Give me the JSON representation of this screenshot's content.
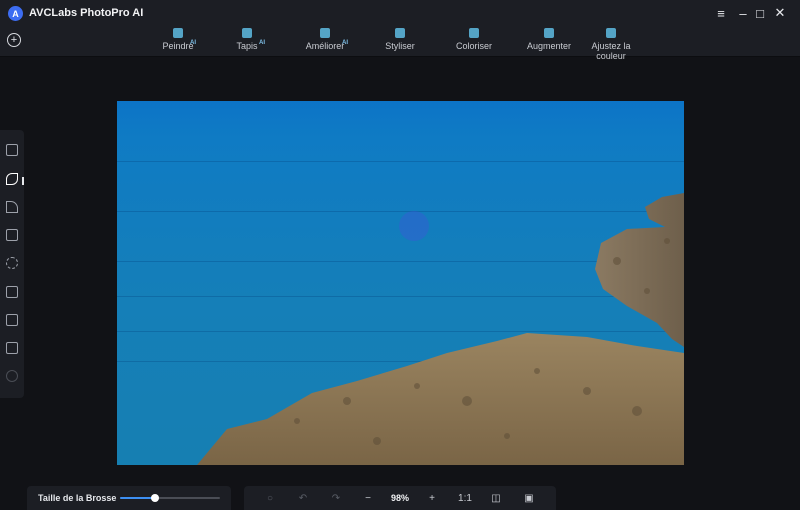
{
  "app": {
    "title": "AVCLabs PhotoPro AI",
    "logo_letter": "A"
  },
  "window_controls": [
    {
      "name": "menu-icon",
      "glyph": "≡"
    },
    {
      "name": "minimize-icon",
      "glyph": "–"
    },
    {
      "name": "maximize-icon",
      "glyph": "□"
    },
    {
      "name": "close-icon",
      "glyph": "✕"
    }
  ],
  "toolbar": {
    "add_glyph": "+",
    "tools": [
      {
        "label": "Peindre",
        "ai": "AI",
        "icon": "paint-icon"
      },
      {
        "label": "Tapis",
        "ai": "AI",
        "icon": "carpet-icon"
      },
      {
        "label": "Améliorer",
        "ai": "AI",
        "icon": "enhance-icon"
      },
      {
        "label": "Styliser",
        "ai": "",
        "icon": "stylize-icon"
      },
      {
        "label": "Coloriser",
        "ai": "",
        "icon": "colorize-icon"
      },
      {
        "label": "Augmenter",
        "ai": "",
        "icon": "upscale-icon"
      },
      {
        "label": "Ajustez la couleur",
        "ai": "",
        "icon": "adjust-color-icon"
      }
    ]
  },
  "sidebar": {
    "tools": [
      {
        "name": "chart-tool-icon",
        "state": "normal"
      },
      {
        "name": "brush-tool-icon",
        "state": "active"
      },
      {
        "name": "lasso-tool-icon",
        "state": "normal"
      },
      {
        "name": "rectangle-select-icon",
        "state": "normal"
      },
      {
        "name": "ellipse-select-icon",
        "state": "normal"
      },
      {
        "name": "person-select-icon",
        "state": "normal"
      },
      {
        "name": "object-select-icon",
        "state": "normal"
      },
      {
        "name": "layers-icon",
        "state": "normal"
      },
      {
        "name": "history-icon",
        "state": "disabled"
      }
    ]
  },
  "brush": {
    "label": "Taille de la Brosse",
    "value_fraction": 0.35
  },
  "bottom_bar": {
    "reset_glyph": "○",
    "undo_glyph": "↶",
    "redo_glyph": "↷",
    "zoom_out_glyph": "−",
    "zoom_level": "98%",
    "zoom_in_glyph": "+",
    "ratio_label": "1:1",
    "compare_glyph": "◫",
    "save_glyph": "▣"
  },
  "colors": {
    "accent": "#3d8ff2",
    "panel": "#1c1e24",
    "background": "#111216",
    "sea": "#157fb8",
    "rock": "#8a7455"
  }
}
